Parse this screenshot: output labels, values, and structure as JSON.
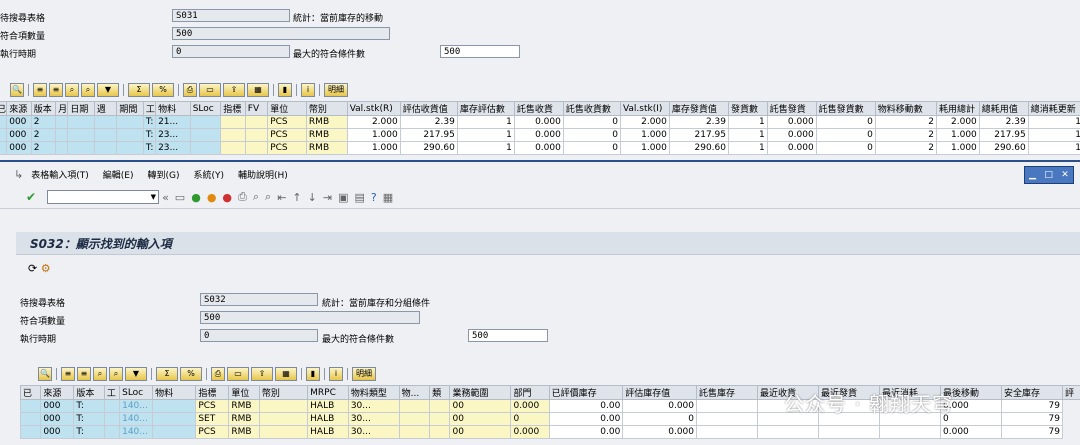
{
  "top": {
    "label_table": "待搜尋表格",
    "label_count": "符合項數量",
    "label_runtime": "執行時期",
    "table_value": "S031",
    "table_desc": "統計：當前庫存的移動",
    "count_value": "500",
    "runtime_value": "0",
    "max_label": "最大的符合條件數",
    "max_value": "500",
    "toolbar": {
      "detail": "明細"
    },
    "columns": [
      "已",
      "來源",
      "版本",
      "月",
      "日期",
      "週",
      "期間",
      "工",
      "物料",
      "SLoc",
      "指標",
      "FV",
      "單位",
      "幣別",
      "Val.stk(R)",
      "評估收貨值",
      "庫存評估數",
      "託售收貨",
      "託售收貨數",
      "Val.stk(I)",
      "庫存發貨值",
      "發貨數",
      "託售發貨",
      "託售發貨數",
      "物料移動數",
      "耗用總計",
      "總耗用值",
      "總消耗更新"
    ],
    "rows": [
      [
        "",
        "000",
        "2",
        "",
        "",
        "",
        "",
        "T:",
        "21...",
        "",
        "",
        "",
        "PCS",
        "RMB",
        "2.000",
        "2.39",
        "1",
        "0.000",
        "0",
        "2.000",
        "2.39",
        "1",
        "0.000",
        "0",
        "2",
        "2.000",
        "2.39",
        "1"
      ],
      [
        "",
        "000",
        "2",
        "",
        "",
        "",
        "",
        "T:",
        "23...",
        "",
        "",
        "",
        "PCS",
        "RMB",
        "1.000",
        "217.95",
        "1",
        "0.000",
        "0",
        "1.000",
        "217.95",
        "1",
        "0.000",
        "0",
        "2",
        "1.000",
        "217.95",
        "1"
      ],
      [
        "",
        "000",
        "2",
        "",
        "",
        "",
        "",
        "T:",
        "23...",
        "",
        "",
        "",
        "PCS",
        "RMB",
        "1.000",
        "290.60",
        "1",
        "0.000",
        "0",
        "1.000",
        "290.60",
        "1",
        "0.000",
        "0",
        "2",
        "1.000",
        "290.60",
        "1"
      ]
    ]
  },
  "window": {
    "menu": [
      "表格輸入項(T)",
      "編輯(E)",
      "轉到(G)",
      "系統(Y)",
      "輔助說明(H)"
    ],
    "title": "S032：顯示找到的輸入項",
    "label_table": "待搜尋表格",
    "label_count": "符合項數量",
    "label_runtime": "執行時期",
    "table_value": "S032",
    "table_desc": "統計：當前庫存和分組條件",
    "count_value": "500",
    "runtime_value": "0",
    "max_label": "最大的符合條件數",
    "max_value": "500",
    "toolbar": {
      "detail": "明細"
    },
    "columns": [
      "已",
      "來源",
      "版本",
      "工",
      "SLoc",
      "物料",
      "指標",
      "單位",
      "幣別",
      "MRPC",
      "物料類型",
      "物...",
      "類",
      "業務範圍",
      "部門",
      "已評價庫存",
      "評估庫存值",
      "託售庫存",
      "最近收貨",
      "最近發貨",
      "最近消耗",
      "最後移動",
      "安全庫存",
      "評"
    ],
    "rows": [
      [
        "",
        "000",
        "T:",
        "",
        "140...",
        "",
        "PCS",
        "RMB",
        "",
        "HALB",
        "30...",
        "",
        "",
        "00",
        "0.000",
        "0.00",
        "0.000",
        "",
        "",
        "",
        "",
        "0.000",
        "79"
      ],
      [
        "",
        "000",
        "T:",
        "",
        "140...",
        "",
        "SET",
        "RMB",
        "",
        "HALB",
        "30...",
        "",
        "",
        "00",
        "0",
        "0.00",
        "0",
        "",
        "",
        "",
        "",
        "0",
        "79"
      ],
      [
        "",
        "000",
        "T:",
        "",
        "140...",
        "",
        "PCS",
        "RMB",
        "",
        "HALB",
        "30...",
        "",
        "",
        "00",
        "0.000",
        "0.00",
        "0.000",
        "",
        "",
        "",
        "",
        "0.000",
        "79"
      ]
    ]
  },
  "watermark": "公众号 · 翱翔天穹"
}
